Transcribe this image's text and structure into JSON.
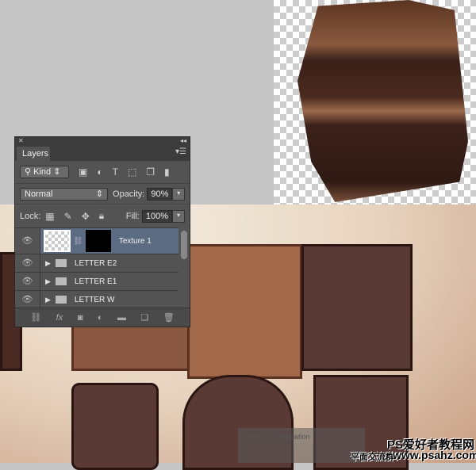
{
  "panel": {
    "title": "Layers",
    "filter": "Kind",
    "blend_mode": "Normal",
    "opacity_label": "Opacity:",
    "opacity": "90%",
    "lock_label": "Lock:",
    "fill_label": "Fill:",
    "fill": "100%"
  },
  "layers": [
    {
      "name": "Texture 1",
      "selected": true
    },
    {
      "name": "LETTER E2"
    },
    {
      "name": "LETTER E1"
    },
    {
      "name": "LETTER W"
    }
  ],
  "footer_fx": "fx",
  "watermark": {
    "caption": "Textbox or translation",
    "site": "PS爱好者教程网",
    "url": "www.psahz.com",
    "group": "平面交流群："
  }
}
